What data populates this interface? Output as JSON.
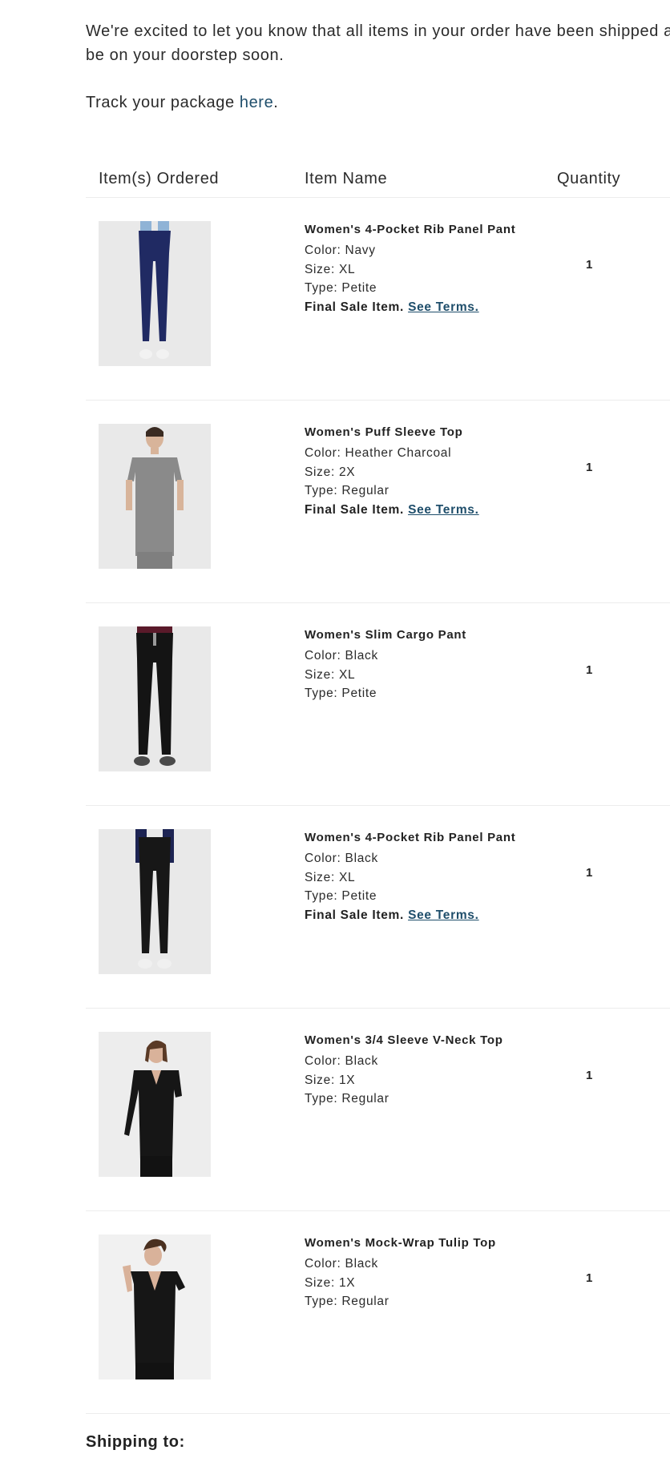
{
  "intro": {
    "line1": "We're excited to let you know that all items in your order have been shipped and will",
    "line2": "be on your doorstep soon."
  },
  "track": {
    "prefix": "Track your package ",
    "link_label": "here",
    "suffix": "."
  },
  "table": {
    "headers": [
      "Item(s) Ordered",
      "Item Name",
      "Quantity"
    ],
    "items": [
      {
        "name": "Women's 4-Pocket Rib Panel Pant",
        "color": "Color: Navy",
        "size": "Size: XL",
        "type": "Type: Petite",
        "final_sale": "Final Sale Item.",
        "terms_link": "See Terms.",
        "quantity": "1",
        "image": "navy-rib-panel-pant"
      },
      {
        "name": "Women's Puff Sleeve Top",
        "color": "Color: Heather Charcoal",
        "size": "Size: 2X",
        "type": "Type: Regular",
        "final_sale": "Final Sale Item.",
        "terms_link": "See Terms.",
        "quantity": "1",
        "image": "heather-charcoal-puff-sleeve-top"
      },
      {
        "name": "Women's Slim Cargo Pant",
        "color": "Color: Black",
        "size": "Size: XL",
        "type": "Type: Petite",
        "final_sale": "",
        "terms_link": "",
        "quantity": "1",
        "image": "black-slim-cargo-pant"
      },
      {
        "name": "Women's 4-Pocket Rib Panel Pant",
        "color": "Color: Black",
        "size": "Size: XL",
        "type": "Type: Petite",
        "final_sale": "Final Sale Item.",
        "terms_link": "See Terms.",
        "quantity": "1",
        "image": "black-rib-panel-pant"
      },
      {
        "name": "Women's 3/4 Sleeve V-Neck Top",
        "color": "Color: Black",
        "size": "Size: 1X",
        "type": "Type: Regular",
        "final_sale": "",
        "terms_link": "",
        "quantity": "1",
        "image": "black-v-neck-top"
      },
      {
        "name": "Women's Mock-Wrap Tulip Top",
        "color": "Color: Black",
        "size": "Size: 1X",
        "type": "Type: Regular",
        "final_sale": "",
        "terms_link": "",
        "quantity": "1",
        "image": "black-mock-wrap-top"
      }
    ]
  },
  "shipping": {
    "heading": "Shipping to:"
  },
  "colors": {
    "link": "#1f4e6b",
    "text": "#2b2b2b",
    "divider": "#ececec",
    "image_bg": "#e9e9e9"
  }
}
